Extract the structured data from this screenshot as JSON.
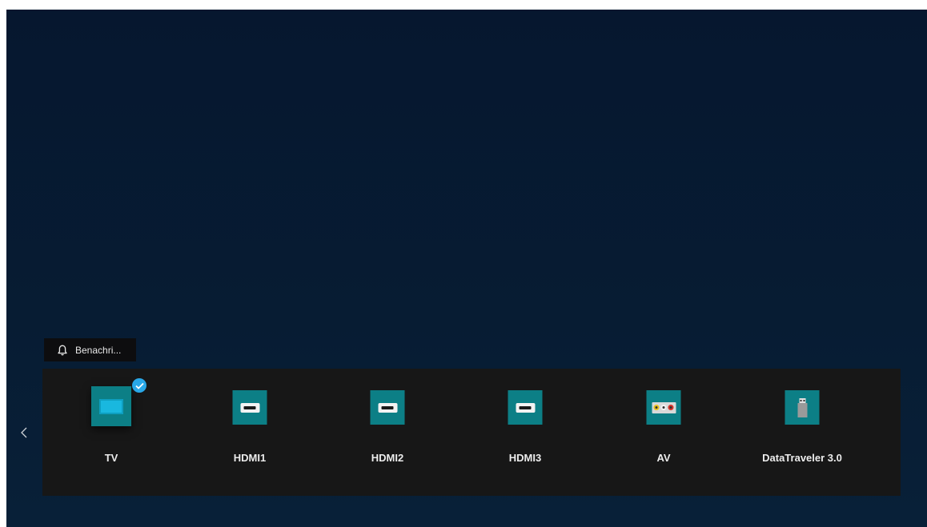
{
  "notification": {
    "label": "Benachri...",
    "icon": "bell-icon"
  },
  "navigation": {
    "back_icon": "chevron-left-icon"
  },
  "sources": [
    {
      "label": "TV",
      "icon": "tv-icon",
      "selected": true
    },
    {
      "label": "HDMI1",
      "icon": "hdmi-icon",
      "selected": false
    },
    {
      "label": "HDMI2",
      "icon": "hdmi-icon",
      "selected": false
    },
    {
      "label": "HDMI3",
      "icon": "hdmi-icon",
      "selected": false
    },
    {
      "label": "AV",
      "icon": "av-icon",
      "selected": false
    },
    {
      "label": "DataTraveler 3.0",
      "icon": "usb-icon",
      "selected": false
    }
  ],
  "colors": {
    "background": "#06172f",
    "bar": "#171717",
    "tile": "#0c7f86",
    "check": "#29a8e8"
  }
}
